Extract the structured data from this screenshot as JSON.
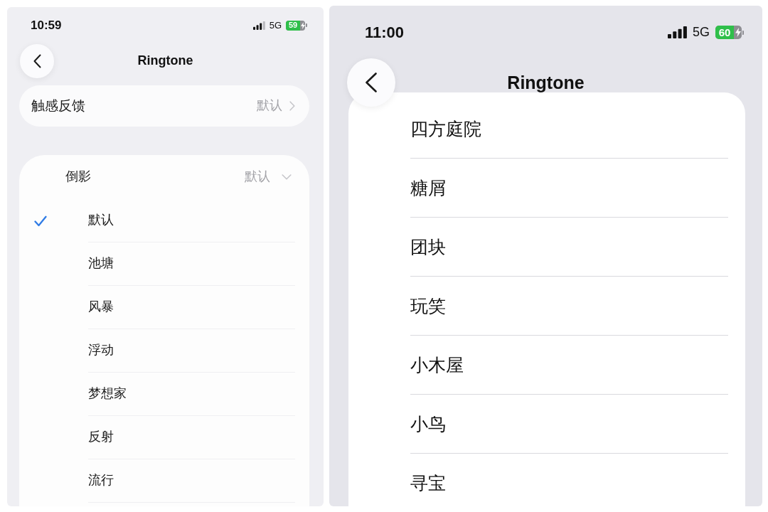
{
  "left_screen": {
    "status_bar": {
      "time": "10:59",
      "network": "5G",
      "battery": "59",
      "charging": true
    },
    "title": "Ringtone",
    "haptics_row": {
      "label": "触感反馈",
      "value": "默认"
    },
    "group": {
      "label": "倒影",
      "value": "默认",
      "expanded": true,
      "options": [
        {
          "label": "默认",
          "selected": true
        },
        {
          "label": "池塘",
          "selected": false
        },
        {
          "label": "风暴",
          "selected": false
        },
        {
          "label": "浮动",
          "selected": false
        },
        {
          "label": "梦想家",
          "selected": false
        },
        {
          "label": "反射",
          "selected": false
        },
        {
          "label": "流行",
          "selected": false
        }
      ]
    }
  },
  "right_screen": {
    "status_bar": {
      "time": "11:00",
      "network": "5G",
      "battery": "60",
      "charging": true
    },
    "title": "Ringtone",
    "ringtones": [
      "四方庭院",
      "糖屑",
      "团块",
      "玩笑",
      "小木屋",
      "小鸟",
      "寻宝"
    ]
  }
}
